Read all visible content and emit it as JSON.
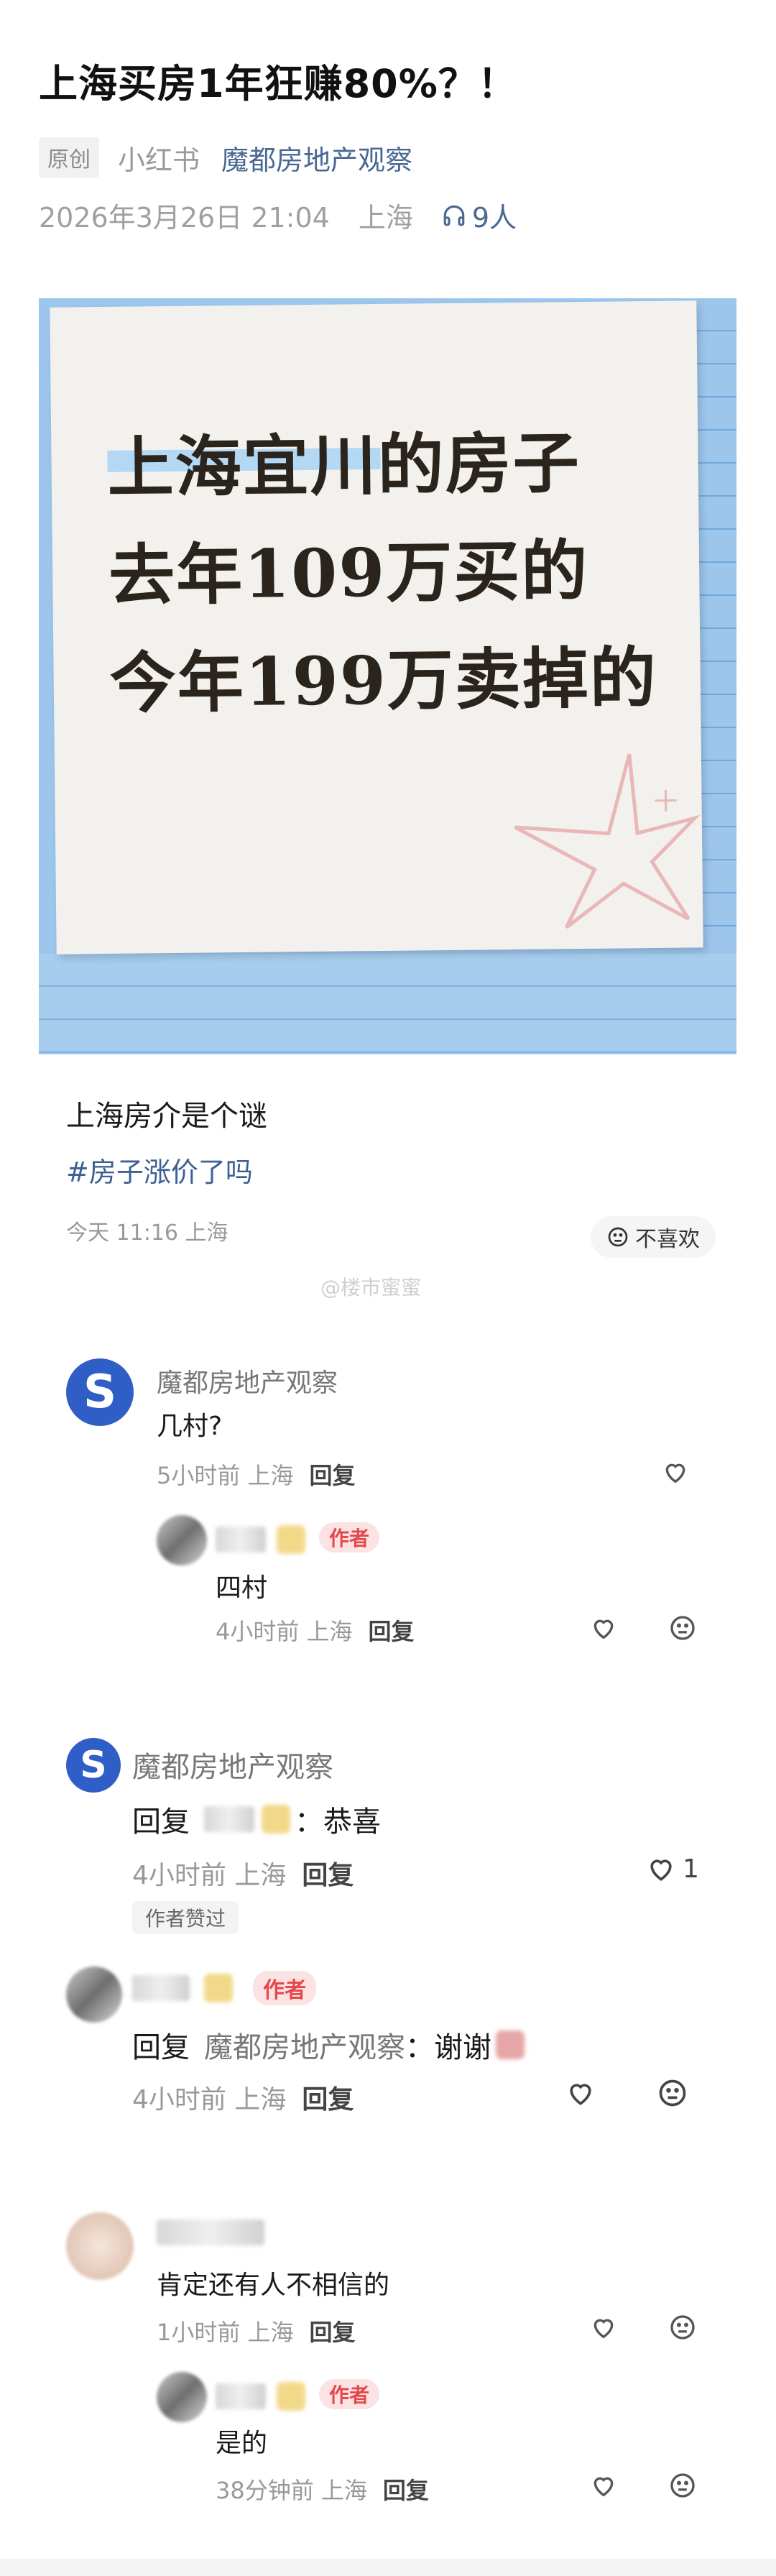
{
  "article": {
    "title": "上海买房1年狂赚80%？！",
    "original_tag": "原创",
    "source": "小红书",
    "account": "魔都房地产观察",
    "date": "2026年3月26日 21:04",
    "location": "上海",
    "listeners": "9人"
  },
  "image_card": {
    "line1": "上海宜川的房子",
    "line2": "去年109万买的",
    "line3": "今年199万卖掉的"
  },
  "post": {
    "text": "上海房介是个谜",
    "hashtag": "#房子涨价了吗",
    "time": "今天 11:16 上海",
    "dislike_label": "不喜欢",
    "watermark": "@楼市蜜蜜"
  },
  "comments": [
    {
      "name": "魔都房地产观察",
      "text": "几村?",
      "meta": "5小时前 上海",
      "reply_label": "回复",
      "reply": {
        "author_tag": "作者",
        "text": "四村",
        "meta": "4小时前 上海",
        "reply_label": "回复"
      }
    },
    {
      "name": "魔都房地产观察",
      "reply_prefix": "回复",
      "text": "：恭喜",
      "meta": "4小时前 上海",
      "reply_label": "回复",
      "likes": "1",
      "liked_badge": "作者赞过",
      "reply": {
        "author_tag": "作者",
        "reply_prefix": "回复",
        "reply_target": "魔都房地产观察",
        "text": "：谢谢",
        "meta": "4小时前 上海",
        "reply_label": "回复"
      }
    },
    {
      "text": "肯定还有人不相信的",
      "meta": "1小时前 上海",
      "reply_label": "回复",
      "reply": {
        "author_tag": "作者",
        "text": "是的",
        "meta": "38分钟前 上海",
        "reply_label": "回复"
      }
    }
  ],
  "icons": [
    "headphones-icon",
    "dislike-face-icon",
    "heart-icon",
    "smile-neutral-icon"
  ],
  "colors": {
    "link": "#4a6894",
    "author_tag_bg": "#fbe3e3",
    "author_tag_fg": "#e5484d",
    "card_blue": "#9dc6ec"
  }
}
